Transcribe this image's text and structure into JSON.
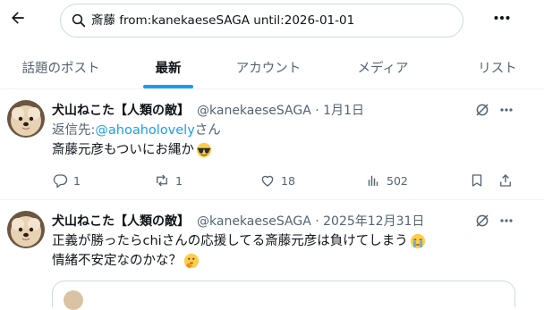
{
  "search": {
    "query": "斎藤 from:kanekaeseSAGA until:2026-01-01"
  },
  "tabs": [
    {
      "label": "話題のポスト",
      "active": false
    },
    {
      "label": "最新",
      "active": true
    },
    {
      "label": "アカウント",
      "active": false
    },
    {
      "label": "メディア",
      "active": false
    },
    {
      "label": "リスト",
      "active": false
    }
  ],
  "posts": [
    {
      "name": "犬山ねこた【人類の敵】",
      "handle": "@kanekaeseSAGA · 1月1日",
      "reply_label": "返信先: ",
      "reply_to": "@ahoaholovely",
      "reply_suffix": "さん",
      "text_lines": [
        "斎藤元彦もついにお縄か"
      ],
      "emoji": [
        "sunglasses-emoji"
      ],
      "stats": {
        "replies": "1",
        "reposts": "1",
        "likes": "18",
        "views": "502"
      }
    },
    {
      "name": "犬山ねこた【人類の敵】",
      "handle": "@kanekaeseSAGA · 2025年12月31日",
      "text_lines": [
        "正義が勝ったらchiさんの応援してる斎藤元彦は負けてしまう",
        "情緒不安定なのかな？"
      ],
      "emoji": [
        "crying-emoji",
        "thinking-emoji"
      ]
    }
  ],
  "colors": {
    "accent": "#1d9bf0",
    "text": "#0f1419",
    "muted": "#536471",
    "border": "#eff3f4"
  }
}
